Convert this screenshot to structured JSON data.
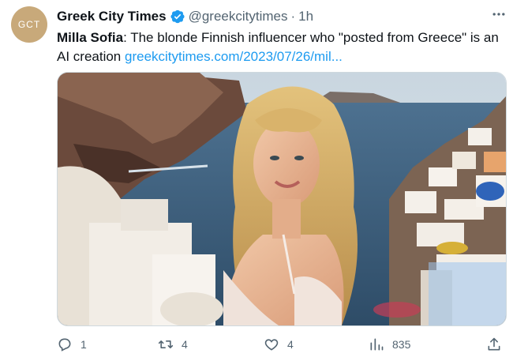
{
  "author": {
    "avatar_text": "GCT",
    "display_name": "Greek City Times",
    "handle": "@greekcitytimes",
    "separator": "·",
    "time": "1h"
  },
  "tweet": {
    "bold_text": "Milla Sofia",
    "body_text": ": The blonde Finnish influencer who \"posted from Greece\" is an AI creation ",
    "link_text": "greekcitytimes.com/2023/07/26/mil..."
  },
  "actions": {
    "replies": "1",
    "retweets": "4",
    "likes": "4",
    "views": "835"
  },
  "colors": {
    "accent": "#1d9bf0",
    "secondary_text": "#536471",
    "avatar_bg": "#c8a97a"
  },
  "icons": [
    "verified-badge-icon",
    "more-options-icon",
    "reply-icon",
    "retweet-icon",
    "like-icon",
    "views-icon",
    "share-icon"
  ]
}
